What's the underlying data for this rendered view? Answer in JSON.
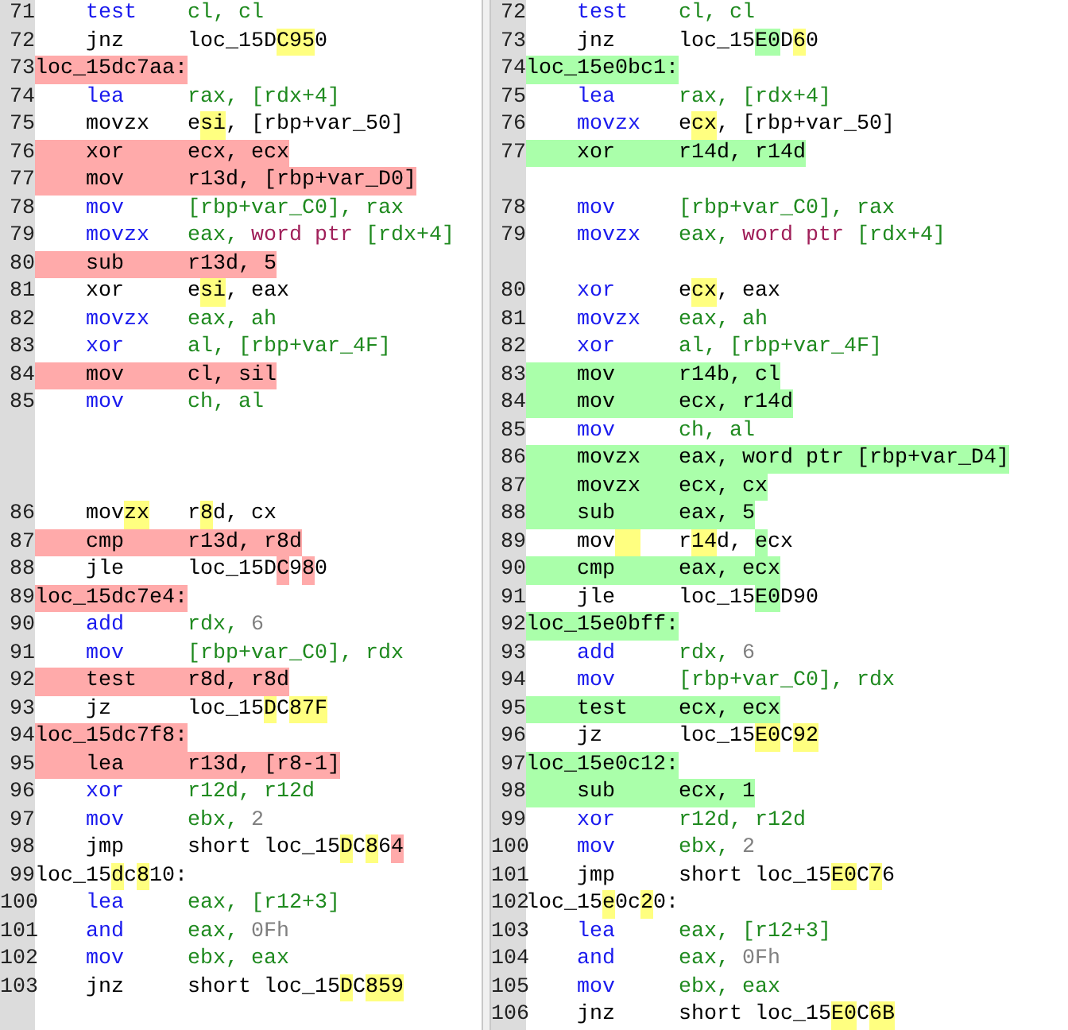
{
  "panes": [
    {
      "kind": "old",
      "rows": [
        {
          "line": "71",
          "kind": "code",
          "changed": false,
          "op": [
            {
              "text": "test",
              "kind": "mnemonic"
            }
          ],
          "args": [
            {
              "text": "cl, cl",
              "kind": "operand"
            }
          ]
        },
        {
          "line": "72",
          "kind": "code",
          "changed": false,
          "op": [
            {
              "text": "jnz"
            }
          ],
          "args": [
            {
              "text": "loc_15D"
            },
            {
              "text": "C95",
              "color": "#ffff80"
            },
            {
              "text": "0"
            }
          ]
        },
        {
          "line": "73",
          "kind": "label",
          "changed": true,
          "args": [
            {
              "text": "loc_15dc7aa:"
            }
          ]
        },
        {
          "line": "74",
          "kind": "code",
          "changed": false,
          "op": [
            {
              "text": "lea",
              "kind": "mnemonic"
            }
          ],
          "args": [
            {
              "text": "rax, [rdx+4]",
              "kind": "operand"
            }
          ]
        },
        {
          "line": "75",
          "kind": "code",
          "changed": false,
          "op": [
            {
              "text": "movzx"
            }
          ],
          "args": [
            {
              "text": "e"
            },
            {
              "text": "si",
              "color": "#ffff80"
            },
            {
              "text": ", [rbp+var_50]"
            }
          ]
        },
        {
          "line": "76",
          "kind": "code",
          "changed": true,
          "op": [
            {
              "text": "xor"
            }
          ],
          "args": [
            {
              "text": "ecx, ecx"
            }
          ]
        },
        {
          "line": "77",
          "kind": "code",
          "changed": true,
          "op": [
            {
              "text": "mov"
            }
          ],
          "args": [
            {
              "text": "r13d, [rbp+var_D0]"
            }
          ]
        },
        {
          "line": "78",
          "kind": "code",
          "changed": false,
          "op": [
            {
              "text": "mov",
              "kind": "mnemonic"
            }
          ],
          "args": [
            {
              "text": "[rbp+var_C0], rax",
              "kind": "operand"
            }
          ]
        },
        {
          "line": "79",
          "kind": "code",
          "changed": false,
          "op": [
            {
              "text": "movzx",
              "kind": "mnemonic"
            }
          ],
          "args": [
            {
              "text": "eax, ",
              "kind": "operand"
            },
            {
              "text": "word ptr",
              "kind": "keyword"
            },
            {
              "text": " [rdx+4]",
              "kind": "operand"
            }
          ]
        },
        {
          "line": "80",
          "kind": "code",
          "changed": true,
          "op": [
            {
              "text": "sub"
            }
          ],
          "args": [
            {
              "text": "r13d, 5"
            }
          ]
        },
        {
          "line": "81",
          "kind": "code",
          "changed": false,
          "op": [
            {
              "text": "xor"
            }
          ],
          "args": [
            {
              "text": "e"
            },
            {
              "text": "si",
              "color": "#ffff80"
            },
            {
              "text": ", eax"
            }
          ]
        },
        {
          "line": "82",
          "kind": "code",
          "changed": false,
          "op": [
            {
              "text": "movzx",
              "kind": "mnemonic"
            }
          ],
          "args": [
            {
              "text": "eax, ah",
              "kind": "operand"
            }
          ]
        },
        {
          "line": "83",
          "kind": "code",
          "changed": false,
          "op": [
            {
              "text": "xor",
              "kind": "mnemonic"
            }
          ],
          "args": [
            {
              "text": "al, [rbp+var_4F]",
              "kind": "operand"
            }
          ]
        },
        {
          "line": "84",
          "kind": "code",
          "changed": true,
          "op": [
            {
              "text": "mov"
            }
          ],
          "args": [
            {
              "text": "cl, sil"
            }
          ]
        },
        {
          "line": "85",
          "kind": "code",
          "changed": false,
          "op": [
            {
              "text": "mov",
              "kind": "mnemonic"
            }
          ],
          "args": [
            {
              "text": "ch, al",
              "kind": "operand"
            }
          ]
        },
        {
          "kind": "blank"
        },
        {
          "kind": "blank"
        },
        {
          "kind": "blank"
        },
        {
          "line": "86",
          "kind": "code",
          "changed": false,
          "op": [
            {
              "text": "mov"
            },
            {
              "text": "zx",
              "color": "#ffff80"
            }
          ],
          "args": [
            {
              "text": "r"
            },
            {
              "text": "8",
              "color": "#ffff80"
            },
            {
              "text": "d, cx"
            }
          ]
        },
        {
          "line": "87",
          "kind": "code",
          "changed": true,
          "op": [
            {
              "text": "cmp"
            }
          ],
          "args": [
            {
              "text": "r13d, r8d"
            }
          ]
        },
        {
          "line": "88",
          "kind": "code",
          "changed": false,
          "op": [
            {
              "text": "jle"
            }
          ],
          "args": [
            {
              "text": "loc_15D"
            },
            {
              "text": "C",
              "color": "#ffaaaa"
            },
            {
              "text": "9"
            },
            {
              "text": "8",
              "color": "#ffaaaa"
            },
            {
              "text": "0"
            }
          ]
        },
        {
          "line": "89",
          "kind": "label",
          "changed": true,
          "args": [
            {
              "text": "loc_15dc7e4:"
            }
          ]
        },
        {
          "line": "90",
          "kind": "code",
          "changed": false,
          "op": [
            {
              "text": "add",
              "kind": "mnemonic"
            }
          ],
          "args": [
            {
              "text": "rdx, ",
              "kind": "operand"
            },
            {
              "text": "6",
              "kind": "number"
            }
          ]
        },
        {
          "line": "91",
          "kind": "code",
          "changed": false,
          "op": [
            {
              "text": "mov",
              "kind": "mnemonic"
            }
          ],
          "args": [
            {
              "text": "[rbp+var_C0], rdx",
              "kind": "operand"
            }
          ]
        },
        {
          "line": "92",
          "kind": "code",
          "changed": true,
          "op": [
            {
              "text": "test"
            }
          ],
          "args": [
            {
              "text": "r8d, r8d"
            }
          ]
        },
        {
          "line": "93",
          "kind": "code",
          "changed": false,
          "op": [
            {
              "text": "jz"
            }
          ],
          "args": [
            {
              "text": "loc_15"
            },
            {
              "text": "D",
              "color": "#ffff80"
            },
            {
              "text": "C"
            },
            {
              "text": "87F",
              "color": "#ffff80"
            }
          ]
        },
        {
          "line": "94",
          "kind": "label",
          "changed": true,
          "args": [
            {
              "text": "loc_15dc7f8:"
            }
          ]
        },
        {
          "line": "95",
          "kind": "code",
          "changed": true,
          "op": [
            {
              "text": "lea"
            }
          ],
          "args": [
            {
              "text": "r13d, [r8-1]"
            }
          ]
        },
        {
          "line": "96",
          "kind": "code",
          "changed": false,
          "op": [
            {
              "text": "xor",
              "kind": "mnemonic"
            }
          ],
          "args": [
            {
              "text": "r12d, r12d",
              "kind": "operand"
            }
          ]
        },
        {
          "line": "97",
          "kind": "code",
          "changed": false,
          "op": [
            {
              "text": "mov",
              "kind": "mnemonic"
            }
          ],
          "args": [
            {
              "text": "ebx, ",
              "kind": "operand"
            },
            {
              "text": "2",
              "kind": "number"
            }
          ]
        },
        {
          "line": "98",
          "kind": "code",
          "changed": false,
          "op": [
            {
              "text": "jmp"
            }
          ],
          "args": [
            {
              "text": "short loc_15"
            },
            {
              "text": "D",
              "color": "#ffff80"
            },
            {
              "text": "C"
            },
            {
              "text": "8",
              "color": "#ffff80"
            },
            {
              "text": "6"
            },
            {
              "text": "4",
              "color": "#ffaaaa"
            }
          ]
        },
        {
          "line": "99",
          "kind": "label",
          "changed": false,
          "args": [
            {
              "text": "loc_15"
            },
            {
              "text": "d",
              "color": "#ffff80"
            },
            {
              "text": "c"
            },
            {
              "text": "8",
              "color": "#ffff80"
            },
            {
              "text": "10:"
            }
          ]
        },
        {
          "line": "100",
          "kind": "code",
          "changed": false,
          "op": [
            {
              "text": "lea",
              "kind": "mnemonic"
            }
          ],
          "args": [
            {
              "text": "eax, [r12+3]",
              "kind": "operand"
            }
          ]
        },
        {
          "line": "101",
          "kind": "code",
          "changed": false,
          "op": [
            {
              "text": "and",
              "kind": "mnemonic"
            }
          ],
          "args": [
            {
              "text": "eax, ",
              "kind": "operand"
            },
            {
              "text": "0Fh",
              "kind": "number"
            }
          ]
        },
        {
          "line": "102",
          "kind": "code",
          "changed": false,
          "op": [
            {
              "text": "mov",
              "kind": "mnemonic"
            }
          ],
          "args": [
            {
              "text": "ebx, eax",
              "kind": "operand"
            }
          ]
        },
        {
          "line": "103",
          "kind": "code",
          "changed": false,
          "op": [
            {
              "text": "jnz"
            }
          ],
          "args": [
            {
              "text": "short loc_15"
            },
            {
              "text": "D",
              "color": "#ffff80"
            },
            {
              "text": "C"
            },
            {
              "text": "859",
              "color": "#ffff80"
            }
          ]
        }
      ]
    },
    {
      "kind": "new",
      "rows": [
        {
          "line": "72",
          "kind": "code",
          "changed": false,
          "op": [
            {
              "text": "test",
              "kind": "mnemonic"
            }
          ],
          "args": [
            {
              "text": "cl, cl",
              "kind": "operand"
            }
          ]
        },
        {
          "line": "73",
          "kind": "code",
          "changed": false,
          "op": [
            {
              "text": "jnz"
            }
          ],
          "args": [
            {
              "text": "loc_15"
            },
            {
              "text": "E0",
              "color": "#aaffaa"
            },
            {
              "text": "D"
            },
            {
              "text": "6",
              "color": "#ffff80"
            },
            {
              "text": "0"
            }
          ]
        },
        {
          "line": "74",
          "kind": "label",
          "changed": true,
          "args": [
            {
              "text": "loc_15e0bc1:"
            }
          ]
        },
        {
          "line": "75",
          "kind": "code",
          "changed": false,
          "op": [
            {
              "text": "lea",
              "kind": "mnemonic"
            }
          ],
          "args": [
            {
              "text": "rax, [rdx+4]",
              "kind": "operand"
            }
          ]
        },
        {
          "line": "76",
          "kind": "code",
          "changed": false,
          "op": [
            {
              "text": "movzx",
              "kind": "mnemonic"
            }
          ],
          "args": [
            {
              "text": "e"
            },
            {
              "text": "cx",
              "color": "#ffff80"
            },
            {
              "text": ", [rbp+var_50]"
            }
          ]
        },
        {
          "line": "77",
          "kind": "code",
          "changed": true,
          "op": [
            {
              "text": "xor"
            }
          ],
          "args": [
            {
              "text": "r14d, r14d"
            }
          ]
        },
        {
          "kind": "blank"
        },
        {
          "line": "78",
          "kind": "code",
          "changed": false,
          "op": [
            {
              "text": "mov",
              "kind": "mnemonic"
            }
          ],
          "args": [
            {
              "text": "[rbp+var_C0], rax",
              "kind": "operand"
            }
          ]
        },
        {
          "line": "79",
          "kind": "code",
          "changed": false,
          "op": [
            {
              "text": "movzx",
              "kind": "mnemonic"
            }
          ],
          "args": [
            {
              "text": "eax, ",
              "kind": "operand"
            },
            {
              "text": "word ptr",
              "kind": "keyword"
            },
            {
              "text": " [rdx+4]",
              "kind": "operand"
            }
          ]
        },
        {
          "kind": "blank"
        },
        {
          "line": "80",
          "kind": "code",
          "changed": false,
          "op": [
            {
              "text": "xor",
              "kind": "mnemonic"
            }
          ],
          "args": [
            {
              "text": "e"
            },
            {
              "text": "cx",
              "color": "#ffff80"
            },
            {
              "text": ", eax"
            }
          ]
        },
        {
          "line": "81",
          "kind": "code",
          "changed": false,
          "op": [
            {
              "text": "movzx",
              "kind": "mnemonic"
            }
          ],
          "args": [
            {
              "text": "eax, ah",
              "kind": "operand"
            }
          ]
        },
        {
          "line": "82",
          "kind": "code",
          "changed": false,
          "op": [
            {
              "text": "xor",
              "kind": "mnemonic"
            }
          ],
          "args": [
            {
              "text": "al, [rbp+var_4F]",
              "kind": "operand"
            }
          ]
        },
        {
          "line": "83",
          "kind": "code",
          "changed": true,
          "op": [
            {
              "text": "mov"
            }
          ],
          "args": [
            {
              "text": "r14b, cl"
            }
          ]
        },
        {
          "line": "84",
          "kind": "code",
          "changed": true,
          "op": [
            {
              "text": "mov"
            }
          ],
          "args": [
            {
              "text": "ecx, r14d"
            }
          ]
        },
        {
          "line": "85",
          "kind": "code",
          "changed": false,
          "op": [
            {
              "text": "mov",
              "kind": "mnemonic"
            }
          ],
          "args": [
            {
              "text": "ch, al",
              "kind": "operand"
            }
          ]
        },
        {
          "line": "86",
          "kind": "code",
          "changed": true,
          "op": [
            {
              "text": "movzx"
            }
          ],
          "args": [
            {
              "text": "eax, word ptr [rbp+var_D4]"
            }
          ]
        },
        {
          "line": "87",
          "kind": "code",
          "changed": true,
          "op": [
            {
              "text": "movzx"
            }
          ],
          "args": [
            {
              "text": "ecx, cx"
            }
          ]
        },
        {
          "line": "88",
          "kind": "code",
          "changed": true,
          "op": [
            {
              "text": "sub"
            }
          ],
          "args": [
            {
              "text": "eax, 5"
            }
          ]
        },
        {
          "line": "89",
          "kind": "code",
          "changed": false,
          "op": [
            {
              "text": "mov"
            },
            {
              "kind": "gap",
              "color": "#ffff80"
            }
          ],
          "args": [
            {
              "text": "r"
            },
            {
              "text": "14",
              "color": "#ffff80"
            },
            {
              "text": "d, "
            },
            {
              "text": "e",
              "color": "#aaffaa"
            },
            {
              "text": "cx"
            }
          ]
        },
        {
          "line": "90",
          "kind": "code",
          "changed": true,
          "op": [
            {
              "text": "cmp"
            }
          ],
          "args": [
            {
              "text": "eax, ecx"
            }
          ]
        },
        {
          "line": "91",
          "kind": "code",
          "changed": false,
          "op": [
            {
              "text": "jle"
            }
          ],
          "args": [
            {
              "text": "loc_15"
            },
            {
              "text": "E0",
              "color": "#aaffaa"
            },
            {
              "text": "D90"
            }
          ]
        },
        {
          "line": "92",
          "kind": "label",
          "changed": true,
          "args": [
            {
              "text": "loc_15e0bff:"
            }
          ]
        },
        {
          "line": "93",
          "kind": "code",
          "changed": false,
          "op": [
            {
              "text": "add",
              "kind": "mnemonic"
            }
          ],
          "args": [
            {
              "text": "rdx, ",
              "kind": "operand"
            },
            {
              "text": "6",
              "kind": "number"
            }
          ]
        },
        {
          "line": "94",
          "kind": "code",
          "changed": false,
          "op": [
            {
              "text": "mov",
              "kind": "mnemonic"
            }
          ],
          "args": [
            {
              "text": "[rbp+var_C0], rdx",
              "kind": "operand"
            }
          ]
        },
        {
          "line": "95",
          "kind": "code",
          "changed": true,
          "op": [
            {
              "text": "test"
            }
          ],
          "args": [
            {
              "text": "ecx, ecx"
            }
          ]
        },
        {
          "line": "96",
          "kind": "code",
          "changed": false,
          "op": [
            {
              "text": "jz"
            }
          ],
          "args": [
            {
              "text": "loc_15"
            },
            {
              "text": "E0",
              "color": "#ffff80"
            },
            {
              "text": "C"
            },
            {
              "text": "92",
              "color": "#ffff80"
            }
          ]
        },
        {
          "line": "97",
          "kind": "label",
          "changed": true,
          "args": [
            {
              "text": "loc_15e0c12:"
            }
          ]
        },
        {
          "line": "98",
          "kind": "code",
          "changed": true,
          "op": [
            {
              "text": "sub"
            }
          ],
          "args": [
            {
              "text": "ecx, 1"
            }
          ]
        },
        {
          "line": "99",
          "kind": "code",
          "changed": false,
          "op": [
            {
              "text": "xor",
              "kind": "mnemonic"
            }
          ],
          "args": [
            {
              "text": "r12d, r12d",
              "kind": "operand"
            }
          ]
        },
        {
          "line": "100",
          "kind": "code",
          "changed": false,
          "op": [
            {
              "text": "mov",
              "kind": "mnemonic"
            }
          ],
          "args": [
            {
              "text": "ebx, ",
              "kind": "operand"
            },
            {
              "text": "2",
              "kind": "number"
            }
          ]
        },
        {
          "line": "101",
          "kind": "code",
          "changed": false,
          "op": [
            {
              "text": "jmp"
            }
          ],
          "args": [
            {
              "text": "short loc_15"
            },
            {
              "text": "E0",
              "color": "#ffff80"
            },
            {
              "text": "C"
            },
            {
              "text": "7",
              "color": "#ffff80"
            },
            {
              "text": "6"
            }
          ]
        },
        {
          "line": "102",
          "kind": "label",
          "changed": false,
          "args": [
            {
              "text": "loc_15"
            },
            {
              "text": "e",
              "color": "#ffff80"
            },
            {
              "text": "0c"
            },
            {
              "text": "2",
              "color": "#ffff80"
            },
            {
              "text": "0:"
            }
          ]
        },
        {
          "line": "103",
          "kind": "code",
          "changed": false,
          "op": [
            {
              "text": "lea",
              "kind": "mnemonic"
            }
          ],
          "args": [
            {
              "text": "eax, [r12+3]",
              "kind": "operand"
            }
          ]
        },
        {
          "line": "104",
          "kind": "code",
          "changed": false,
          "op": [
            {
              "text": "and",
              "kind": "mnemonic"
            }
          ],
          "args": [
            {
              "text": "eax, ",
              "kind": "operand"
            },
            {
              "text": "0Fh",
              "kind": "number"
            }
          ]
        },
        {
          "line": "105",
          "kind": "code",
          "changed": false,
          "op": [
            {
              "text": "mov",
              "kind": "mnemonic"
            }
          ],
          "args": [
            {
              "text": "ebx, eax",
              "kind": "operand"
            }
          ]
        },
        {
          "line": "106",
          "kind": "code",
          "changed": false,
          "op": [
            {
              "text": "jnz"
            }
          ],
          "args": [
            {
              "text": "short loc_15"
            },
            {
              "text": "E0",
              "color": "#ffff80"
            },
            {
              "text": "C"
            },
            {
              "text": "6B",
              "color": "#ffff80"
            }
          ]
        }
      ]
    }
  ]
}
